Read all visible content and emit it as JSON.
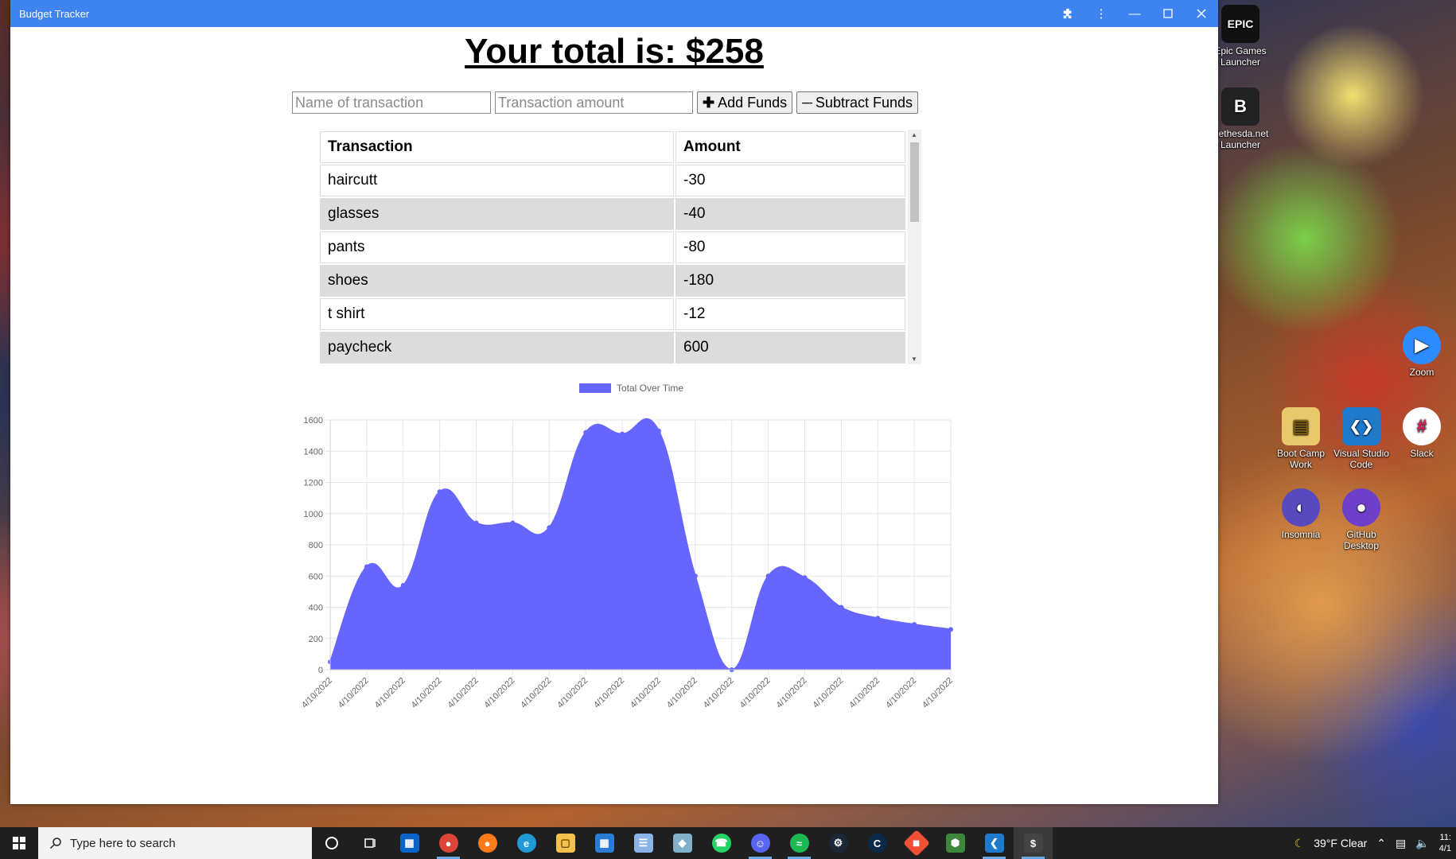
{
  "window": {
    "title": "Budget Tracker"
  },
  "total": {
    "text": "Your total is: $258"
  },
  "form": {
    "name_placeholder": "Name of transaction",
    "amount_placeholder": "Transaction amount",
    "add_label": "Add Funds",
    "subtract_label": "Subtract Funds"
  },
  "table": {
    "headers": [
      "Transaction",
      "Amount"
    ],
    "rows": [
      {
        "name": "haircutt",
        "amount": "-30"
      },
      {
        "name": "glasses",
        "amount": "-40"
      },
      {
        "name": "pants",
        "amount": "-80"
      },
      {
        "name": "shoes",
        "amount": "-180"
      },
      {
        "name": "t shirt",
        "amount": "-12"
      },
      {
        "name": "paycheck",
        "amount": "600"
      }
    ]
  },
  "chart_data": {
    "type": "area",
    "title": "",
    "series": [
      {
        "name": "Total Over Time",
        "color": "#6666ff",
        "values": [
          50,
          660,
          540,
          1140,
          940,
          940,
          910,
          1520,
          1510,
          1530,
          600,
          0,
          600,
          590,
          400,
          330,
          290,
          258
        ]
      }
    ],
    "categories": [
      "4/10/2022",
      "4/10/2022",
      "4/10/2022",
      "4/10/2022",
      "4/10/2022",
      "4/10/2022",
      "4/10/2022",
      "4/10/2022",
      "4/10/2022",
      "4/10/2022",
      "4/10/2022",
      "4/10/2022",
      "4/10/2022",
      "4/10/2022",
      "4/10/2022",
      "4/10/2022",
      "4/10/2022",
      "4/10/2022"
    ],
    "yticks": [
      0,
      200,
      400,
      600,
      800,
      1000,
      1200,
      1400,
      1600
    ],
    "ylim": [
      0,
      1600
    ],
    "grid": true,
    "legend": "top"
  },
  "desktop": {
    "icons": [
      {
        "label": "Epic Games Launcher",
        "glyph": "EPIC",
        "color": "#111111"
      },
      {
        "label": "Bethesda.net Launcher",
        "glyph": "B",
        "color": "#222222"
      },
      {
        "label": "Zoom",
        "glyph": "▶",
        "color": "#2d8cff"
      },
      {
        "label": "Boot Camp Work",
        "glyph": "▤",
        "color": "#e8c86a"
      },
      {
        "label": "Visual Studio Code",
        "glyph": "❮❯",
        "color": "#1e7acc"
      },
      {
        "label": "Slack",
        "glyph": "#",
        "color": "#4a154b"
      },
      {
        "label": "Insomnia",
        "glyph": "◐",
        "color": "#5849be"
      },
      {
        "label": "GitHub Desktop",
        "glyph": "●",
        "color": "#6e40c9"
      }
    ]
  },
  "taskbar": {
    "search_placeholder": "Type here to search",
    "weather": "39°F Clear",
    "time": "11:",
    "date": "4/1"
  }
}
